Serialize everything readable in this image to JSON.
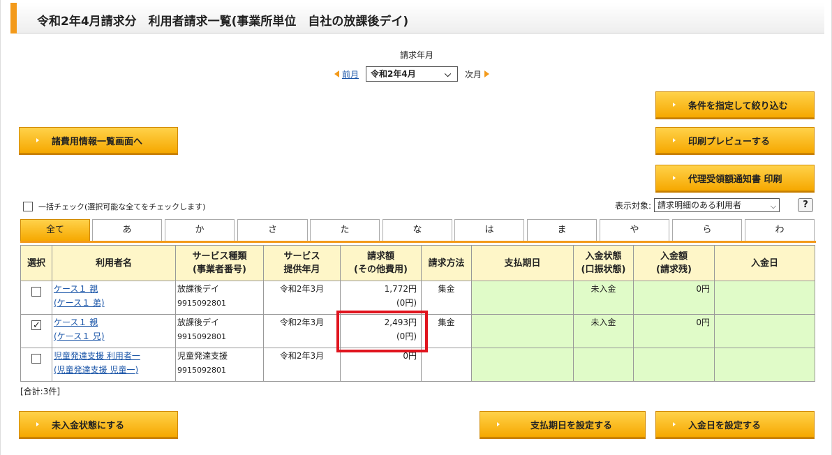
{
  "header": {
    "title": "令和2年4月請求分　利用者請求一覧(事業所単位　自社の放課後デイ)"
  },
  "month": {
    "label": "請求年月",
    "prev": "前月",
    "selected": "令和2年4月",
    "next": "次月"
  },
  "buttons": {
    "filter": "条件を指定して絞り込む",
    "cost_list": "諸費用情報一覧画面へ",
    "print_preview": "印刷プレビューする",
    "proxy_notice": "代理受領額通知書 印刷",
    "set_unpaid": "未入金状態にする",
    "set_due": "支払期日を設定する",
    "set_paid_date": "入金日を設定する"
  },
  "checkall": {
    "label": "一括チェック(選択可能な全てをチェックします)"
  },
  "filter": {
    "label": "表示対象:",
    "selected": "請求明細のある利用者",
    "help": "?"
  },
  "tabs": [
    "全て",
    "あ",
    "か",
    "さ",
    "た",
    "な",
    "は",
    "ま",
    "や",
    "ら",
    "わ"
  ],
  "table": {
    "headers": {
      "select": "選択",
      "name": "利用者名",
      "service_type_1": "サービス種類",
      "service_type_2": "(事業者番号)",
      "service_month_1": "サービス",
      "service_month_2": "提供年月",
      "amount_1": "請求額",
      "amount_2": "(その他費用)",
      "method": "請求方法",
      "due": "支払期日",
      "status_1": "入金状態",
      "status_2": "(口振状態)",
      "paid_1": "入金額",
      "paid_2": "(請求残)",
      "paid_date": "入金日"
    },
    "rows": [
      {
        "checked": false,
        "name1": "ケース１ 親",
        "name2": "(ケース１ 弟)",
        "service": "放課後デイ",
        "number": "9915092801",
        "month": "令和2年3月",
        "amount": "1,772円",
        "other": "(0円)",
        "method": "集金",
        "due": "",
        "status": "未入金",
        "paid": "0円",
        "paid_date": ""
      },
      {
        "checked": true,
        "name1": "ケース１ 親",
        "name2": "(ケース１ 兄)",
        "service": "放課後デイ",
        "number": "9915092801",
        "month": "令和2年3月",
        "amount": "2,493円",
        "other": "(0円)",
        "method": "集金",
        "due": "",
        "status": "未入金",
        "paid": "0円",
        "paid_date": ""
      },
      {
        "checked": false,
        "name1": "児童発達支援 利用者一",
        "name2": "(児童発達支援 児童一)",
        "service": "児童発達支援",
        "number": "9915092801",
        "month": "令和2年3月",
        "amount": "0円",
        "other": "",
        "method": "",
        "due": "",
        "status": "",
        "paid": "",
        "paid_date": ""
      }
    ]
  },
  "total": "[合計:3件]"
}
